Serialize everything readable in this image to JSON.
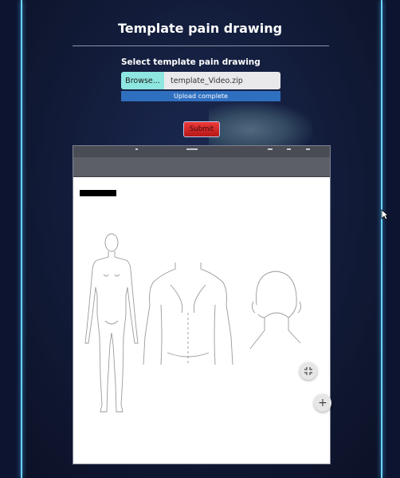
{
  "page": {
    "title": "Template pain drawing",
    "select_label": "Select template pain drawing"
  },
  "file_input": {
    "browse_label": "Browse...",
    "file_name": "template_Video.zip"
  },
  "upload": {
    "status": "Upload complete",
    "progress": 1.0
  },
  "submit_label": "Submit",
  "colors": {
    "accent_line": "#6ad4ff",
    "progress": "#2f6fc0",
    "submit": "#d92626",
    "browse": "#8ee6e0"
  },
  "viewer": {
    "icons": [
      "collapse-icon",
      "zoom-in-icon"
    ]
  }
}
